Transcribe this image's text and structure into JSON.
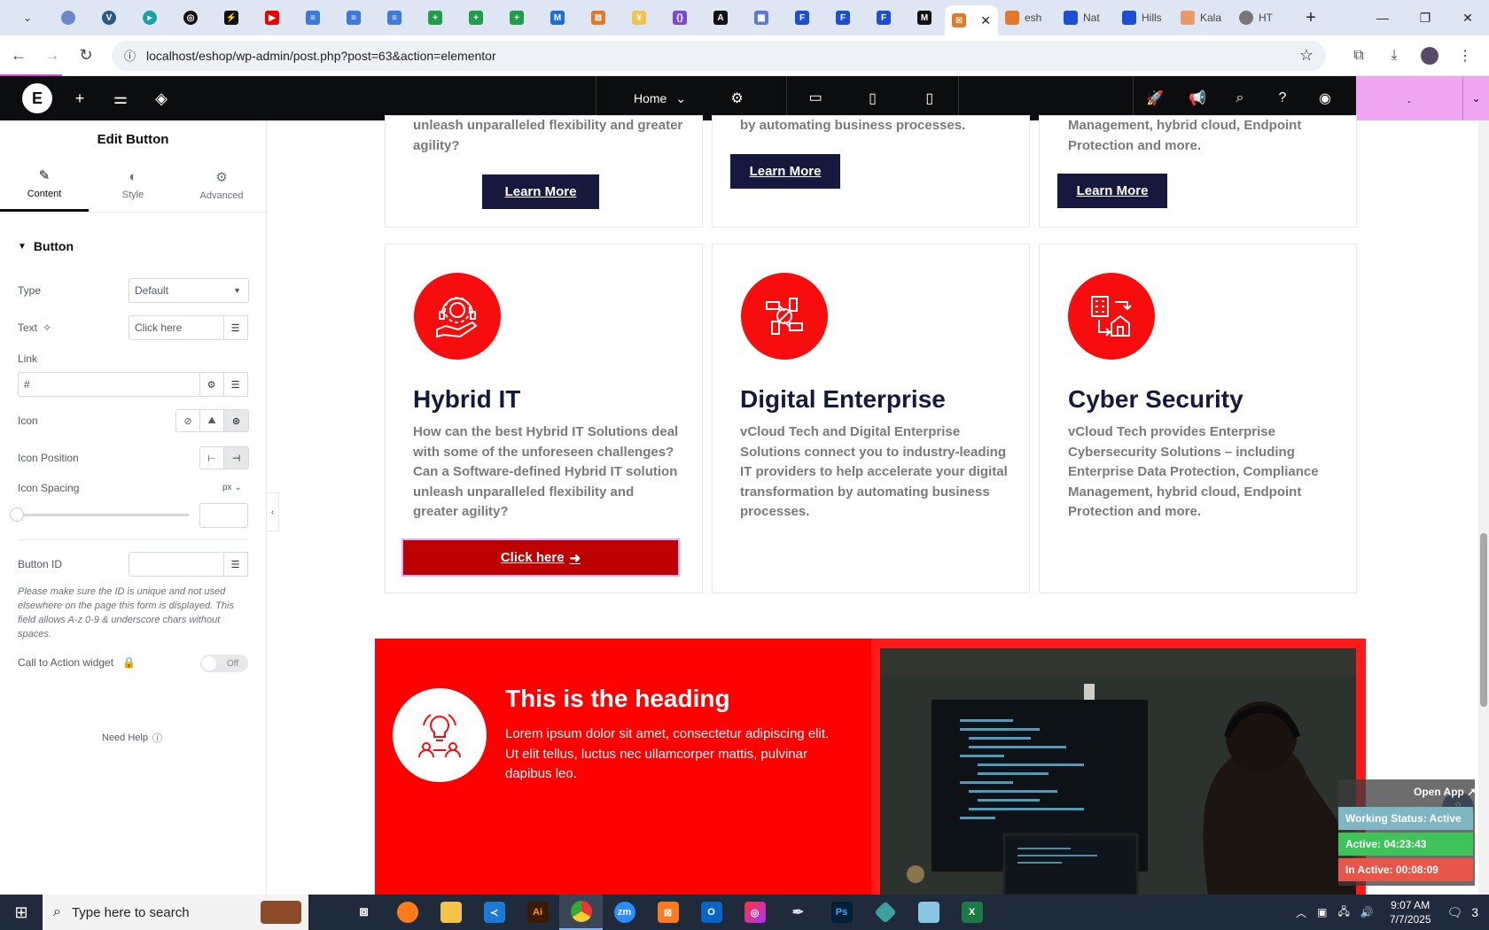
{
  "browser": {
    "tabs_partial": [
      "esh",
      "Nat",
      "Hills",
      "Kala",
      "HT"
    ],
    "url": "localhost/eshop/wp-admin/post.php?post=63&action=elementor"
  },
  "elementor": {
    "page_name": "Home",
    "publish_label": "."
  },
  "panel": {
    "title": "Edit Button",
    "tabs": [
      {
        "label": "Content",
        "icon": "pencil-icon"
      },
      {
        "label": "Style",
        "icon": "half-circle-icon"
      },
      {
        "label": "Advanced",
        "icon": "gear-icon"
      }
    ],
    "section": "Button",
    "type_label": "Type",
    "type_value": "Default",
    "text_label": "Text",
    "text_value": "Click here",
    "link_label": "Link",
    "link_value": "#",
    "icon_label": "Icon",
    "icon_position_label": "Icon Position",
    "icon_spacing_label": "Icon Spacing",
    "icon_spacing_unit": "px",
    "button_id_label": "Button ID",
    "hint": "Please make sure the ID is unique and not used elsewhere on the page this form is displayed. This field allows A-z 0-9 & underscore chars without spaces.",
    "cta_label": "Call to Action widget",
    "toggle_value": "Off",
    "need_help": "Need Help"
  },
  "canvas": {
    "top_cards": [
      {
        "text": "unleash unparalleled flexibility and greater\nagility?",
        "button": "Learn More"
      },
      {
        "text": "by automating business processes.",
        "button": "Learn More"
      },
      {
        "text": "Management, hybrid cloud, Endpoint\nProtection and more.",
        "button": "Learn More"
      }
    ],
    "cards": [
      {
        "title": "Hybrid IT",
        "text": "How can the best Hybrid IT Solutions deal with some of the unforeseen challenges? Can a Software-defined Hybrid IT solution unleash unparalleled flexibility and greater agility?",
        "button": "Click here",
        "icon": "gear-support-icon"
      },
      {
        "title": "Digital Enterprise",
        "text": "vCloud Tech and Digital Enterprise Solutions connect you to industry-leading IT providers to help accelerate your digital transformation by automating business processes.",
        "icon": "hands-collaboration-icon"
      },
      {
        "title": "Cyber Security",
        "text": "vCloud Tech provides Enterprise Cybersecurity Solutions – including Enterprise Data Protection, Compliance Management, hybrid cloud, Endpoint Protection and more.",
        "icon": "building-transfer-icon"
      }
    ],
    "cta": {
      "heading": "This is the heading",
      "text": "Lorem ipsum dolor sit amet, consectetur adipiscing elit. Ut elit tellus, luctus nec ullamcorper mattis, pulvinar dapibus leo."
    }
  },
  "widget": {
    "open_app": "Open App ↗",
    "working_status": "Working Status: Active",
    "active": "Active: 04:23:43",
    "inactive": "In Active: 00:08:09"
  },
  "taskbar": {
    "search_placeholder": "Type here to search",
    "time": "9:07 AM",
    "date": "7/7/2025",
    "notifications": "3"
  }
}
